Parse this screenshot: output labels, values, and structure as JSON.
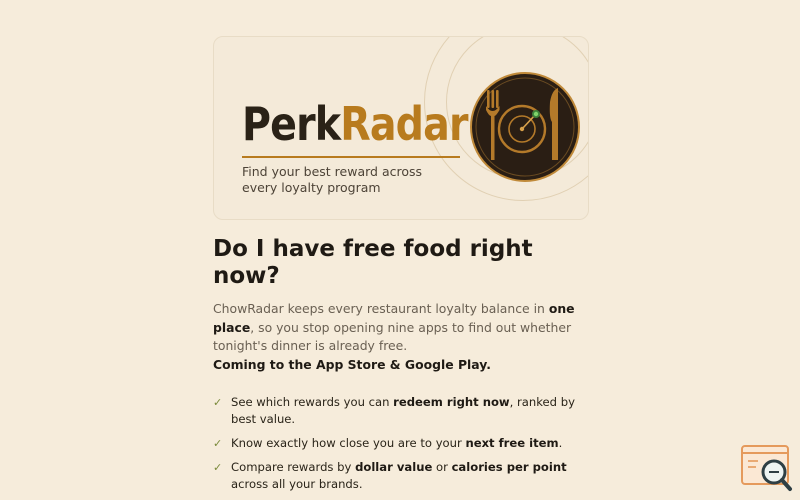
{
  "hero": {
    "brand_part1": "Perk",
    "brand_part2": "Radar",
    "tagline": "Find your best reward across every loyalty program",
    "logo_icon": "plate-radar-icon"
  },
  "main": {
    "heading": "Do I have free food right now?",
    "intro": {
      "part1": "ChowRadar keeps every restaurant loyalty balance in ",
      "bold1": "one place",
      "part2": ", so you stop opening nine apps to find out whether tonight's dinner is already free."
    },
    "coming_soon": "Coming to the App Store & Google Play.",
    "features": [
      {
        "check": "✓",
        "pre": "See which rewards you can ",
        "bold": "redeem right now",
        "post": ", ranked by best value."
      },
      {
        "check": "✓",
        "pre": "Know exactly how close you are to your ",
        "bold": "next free item",
        "post": "."
      },
      {
        "check": "✓",
        "pre": "Compare rewards by ",
        "bold": "dollar value",
        "mid": " or ",
        "bold2": "calories per point",
        "post": " across all your brands."
      }
    ]
  },
  "widget": {
    "icon": "browser-search-icon"
  },
  "colors": {
    "background": "#f6ecdb",
    "accent": "#b87b1e",
    "text": "#1f1a14",
    "muted": "#6a6053",
    "check": "#7a8a3a"
  }
}
